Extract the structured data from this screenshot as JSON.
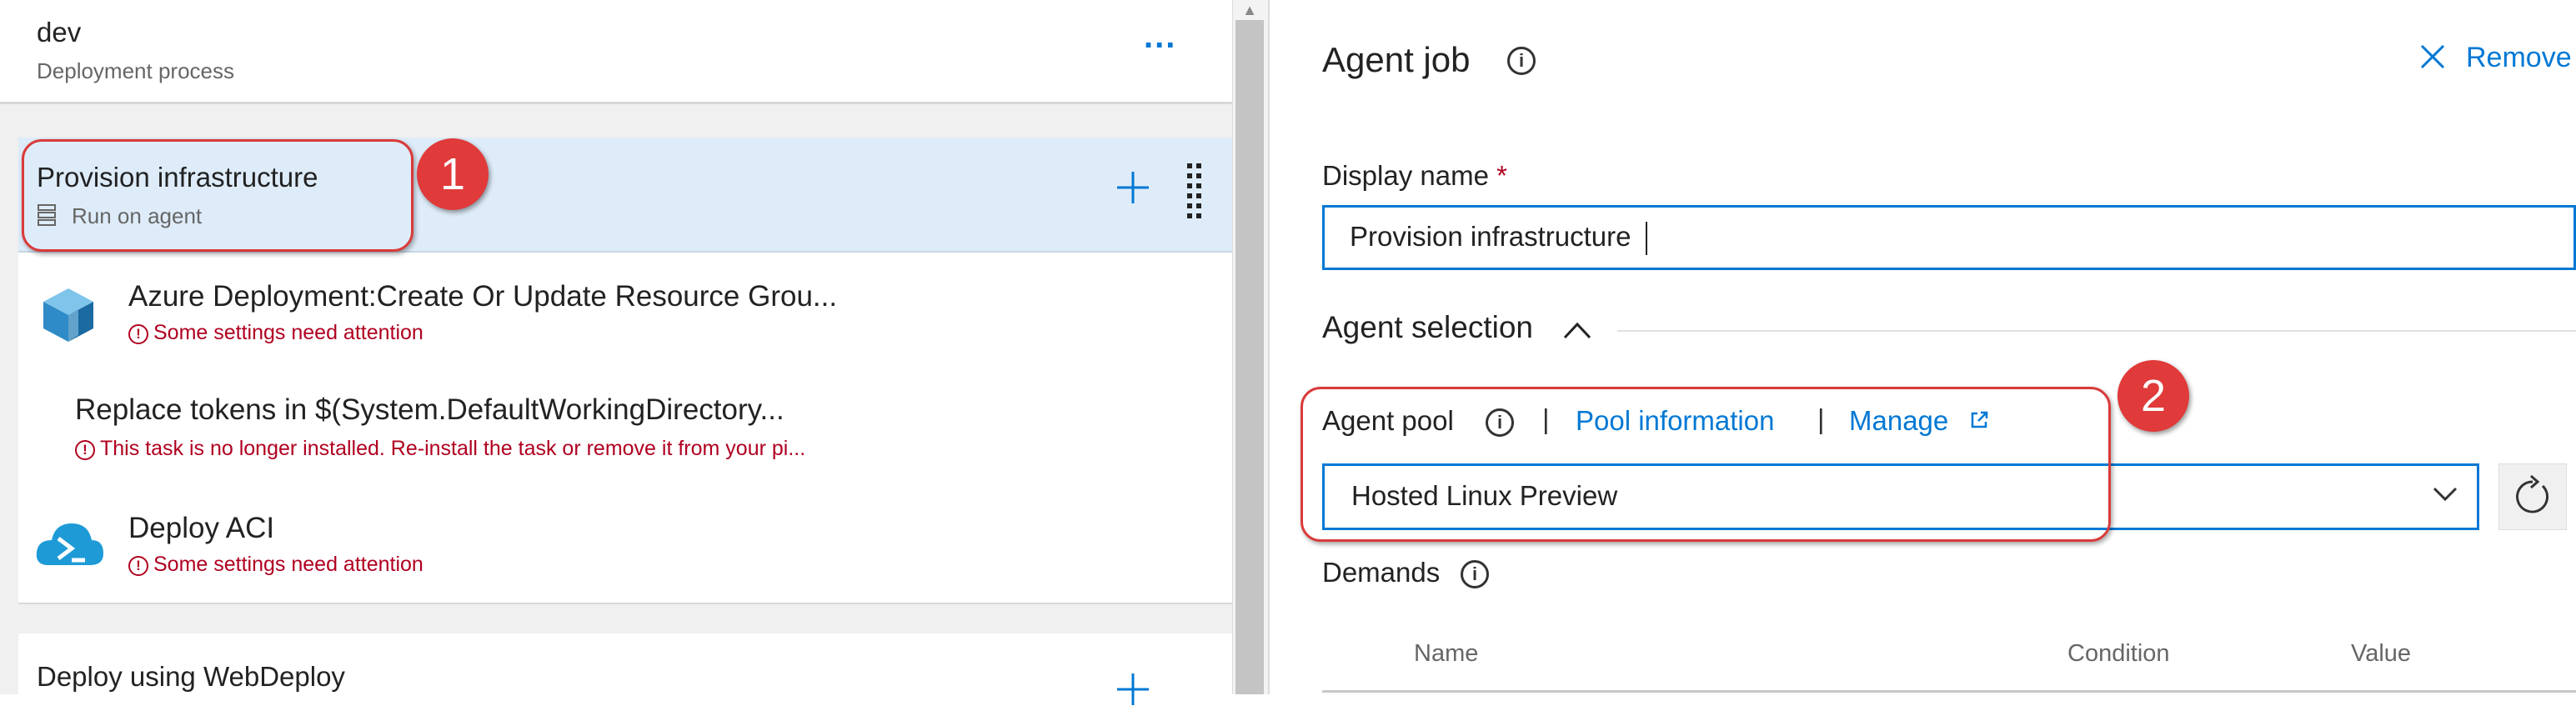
{
  "left": {
    "header": {
      "title": "dev",
      "subtitle": "Deployment process",
      "more_label": "..."
    },
    "phase1": {
      "title": "Provision infrastructure",
      "subtitle": "Run on agent"
    },
    "tasks": [
      {
        "title": "Azure Deployment:Create Or Update Resource Grou...",
        "error": "Some settings need attention",
        "icon": "azure-resource-group-icon"
      },
      {
        "title": "Replace tokens in $(System.DefaultWorkingDirectory...",
        "error": "This task is no longer installed. Re-install the task or remove it from your pi..."
      },
      {
        "title": "Deploy ACI",
        "error": "Some settings need attention",
        "icon": "azure-cloud-powershell-icon"
      }
    ],
    "phase2": {
      "title": "Deploy using WebDeploy"
    }
  },
  "right": {
    "title": "Agent job",
    "remove_label": "Remove",
    "display_name": {
      "label": "Display name",
      "required": "*",
      "value": "Provision infrastructure"
    },
    "agent_selection": {
      "label": "Agent selection"
    },
    "agent_pool": {
      "label": "Agent pool",
      "sep": "|",
      "pool_info_link": "Pool information",
      "manage_link": "Manage",
      "selected": "Hosted Linux Preview"
    },
    "demands": {
      "label": "Demands",
      "columns": [
        "Name",
        "Condition",
        "Value"
      ]
    }
  },
  "callouts": {
    "one": "1",
    "two": "2"
  },
  "colors": {
    "accent": "#0078d4",
    "error": "#b00020",
    "selection": "#deecf9",
    "callout": "#e03a3a"
  }
}
